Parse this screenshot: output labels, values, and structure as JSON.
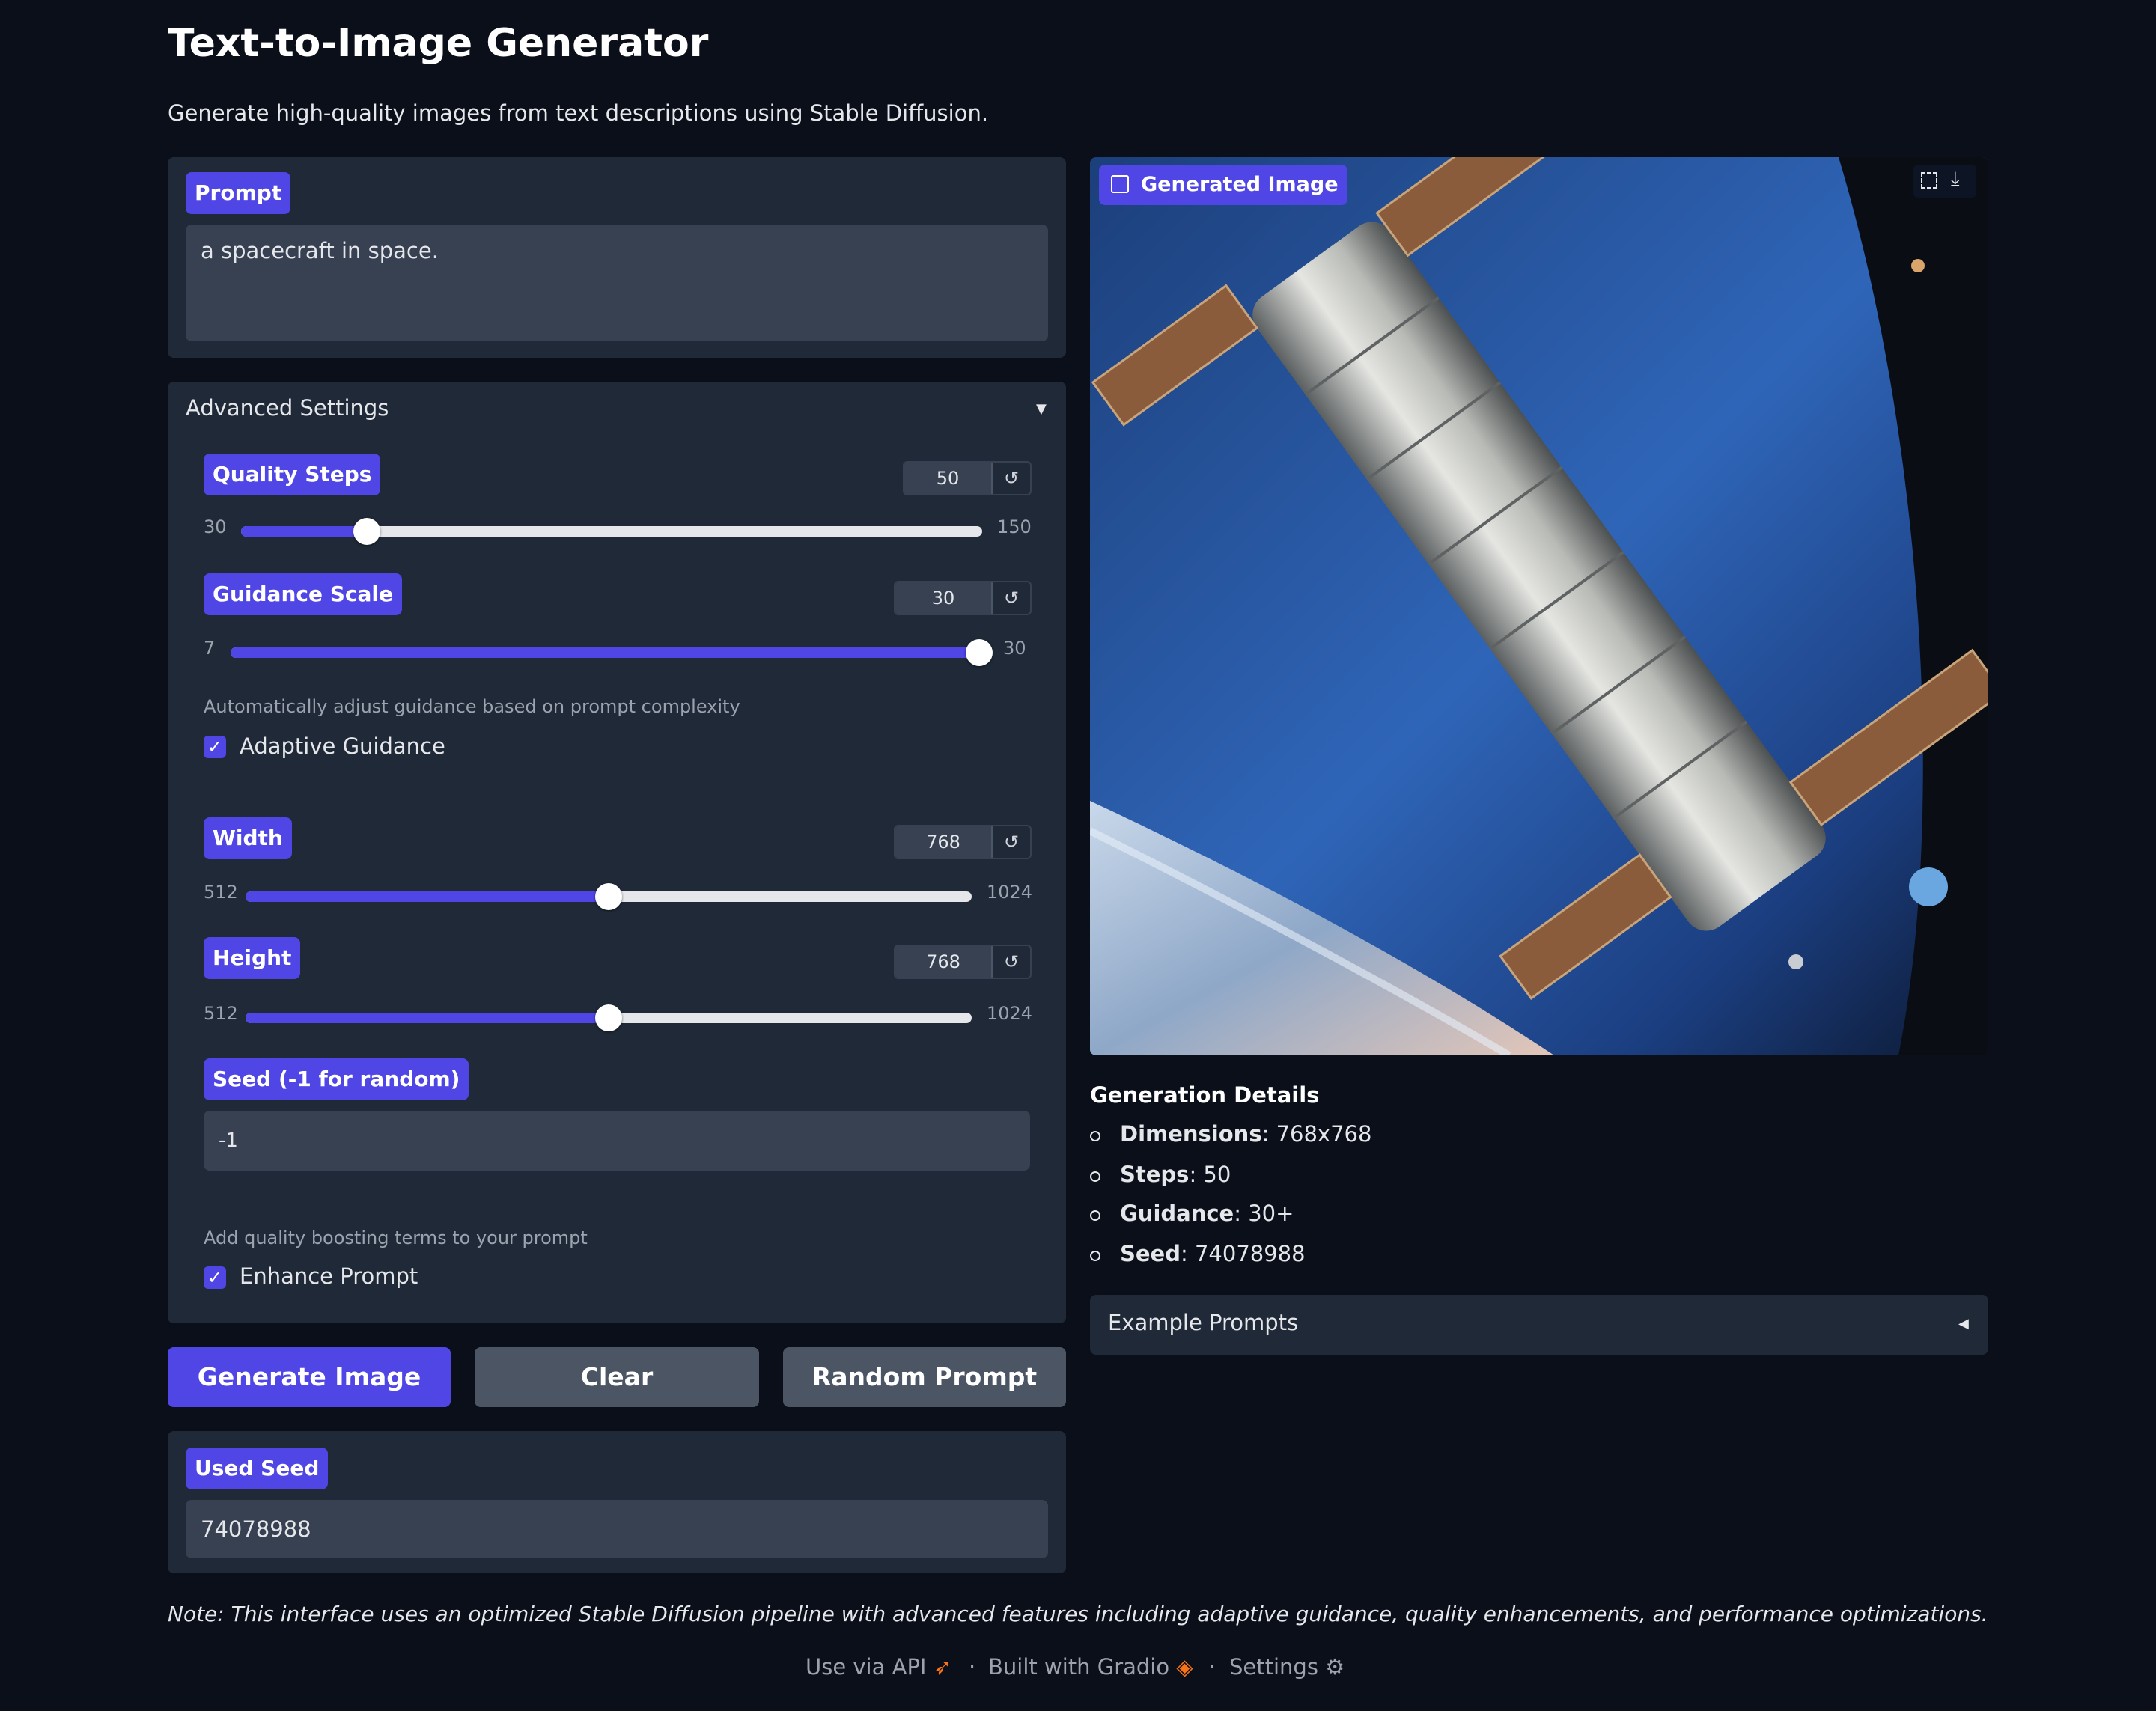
{
  "header": {
    "title": "Text-to-Image Generator",
    "subtitle": "Generate high-quality images from text descriptions using Stable Diffusion."
  },
  "prompt": {
    "label": "Prompt",
    "value": "a spacecraft in space."
  },
  "advanced": {
    "title": "Advanced Settings",
    "toggle": "▼",
    "quality_steps": {
      "label": "Quality Steps",
      "value": "50",
      "min": "30",
      "max": "150",
      "level": 0.17
    },
    "guidance_scale": {
      "label": "Guidance Scale",
      "value": "30",
      "min": "7",
      "max": "30",
      "level": 1.0
    },
    "adaptive_info": "Automatically adjust guidance based on prompt complexity",
    "adaptive_label": "Adaptive Guidance",
    "width": {
      "label": "Width",
      "value": "768",
      "min": "512",
      "max": "1024",
      "level": 0.5
    },
    "height": {
      "label": "Height",
      "value": "768",
      "min": "512",
      "max": "1024",
      "level": 0.5
    },
    "seed": {
      "label": "Seed (-1 for random)",
      "value": "-1"
    },
    "enhance_info": "Add quality boosting terms to your prompt",
    "enhance_label": "Enhance Prompt",
    "reset_glyph": "↺"
  },
  "buttons": {
    "generate": "Generate Image",
    "clear": "Clear",
    "random": "Random Prompt"
  },
  "used_seed": {
    "label": "Used Seed",
    "value": "74078988"
  },
  "output": {
    "label": "Generated Image"
  },
  "details": {
    "title": "Generation Details",
    "items": [
      {
        "key": "Dimensions",
        "value": ": 768x768"
      },
      {
        "key": "Steps",
        "value": ": 50"
      },
      {
        "key": "Guidance",
        "value": ": 30+"
      },
      {
        "key": "Seed",
        "value": ": 74078988"
      }
    ]
  },
  "examples": {
    "title": "Example Prompts",
    "toggle": "◀"
  },
  "note": "Note: This interface uses an optimized Stable Diffusion pipeline with advanced features including adaptive guidance, quality enhancements, and performance optimizations.",
  "footer": {
    "api": "Use via API",
    "gradio": "Built with Gradio",
    "settings": "Settings",
    "sep": "·"
  },
  "colors": {
    "accent": "#4f46e5",
    "panel": "#1f2937",
    "background": "#0b0f19",
    "input": "#374151"
  }
}
